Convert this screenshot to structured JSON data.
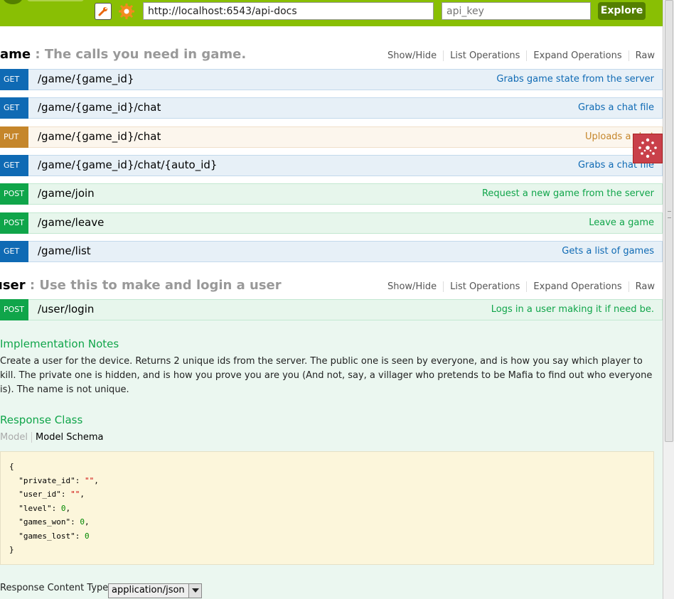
{
  "header": {
    "url_value": "http://localhost:6543/api-docs",
    "api_key_placeholder": "api_key",
    "explore_label": "Explore",
    "brand_color": "#89bf04"
  },
  "resources": [
    {
      "name": "ame",
      "description": " : The calls you need in game.",
      "ops_links": [
        "Show/Hide",
        "List Operations",
        "Expand Operations",
        "Raw"
      ]
    },
    {
      "name": "user",
      "description": " : Use this to make and login a user",
      "ops_links": [
        "Show/Hide",
        "List Operations",
        "Expand Operations",
        "Raw"
      ]
    }
  ],
  "game_ops": [
    {
      "method": "GET",
      "path": "/game/{game_id}",
      "summary": "Grabs game state from the server"
    },
    {
      "method": "GET",
      "path": "/game/{game_id}/chat",
      "summary": "Grabs a chat file"
    },
    {
      "method": "PUT",
      "path": "/game/{game_id}/chat",
      "summary": "Uploads a chat"
    },
    {
      "method": "GET",
      "path": "/game/{game_id}/chat/{auto_id}",
      "summary": "Grabs a chat file"
    },
    {
      "method": "POST",
      "path": "/game/join",
      "summary": "Request a new game from the server"
    },
    {
      "method": "POST",
      "path": "/game/leave",
      "summary": "Leave a game"
    },
    {
      "method": "GET",
      "path": "/game/list",
      "summary": "Gets a list of games"
    }
  ],
  "user_ops": [
    {
      "method": "POST",
      "path": "/user/login",
      "summary": "Logs in a user making it if need be."
    }
  ],
  "details": {
    "impl_title": "Implementation Notes",
    "impl_text": "Create a user for the device. Returns 2 unique ids from the server. The public one is seen by everyone, and is how you say which player to kill. The private one is hidden, and is how you prove you are you (And not, say, a villager who pretends to be Mafia to find out who everyone is). The name is not unique.",
    "response_class_title": "Response Class",
    "tab_model": "Model",
    "tab_schema": "Model Schema",
    "schema_fields": [
      {
        "key": "\"private_id\"",
        "value": "\"\"",
        "type": "string"
      },
      {
        "key": "\"user_id\"",
        "value": "\"\"",
        "type": "string"
      },
      {
        "key": "\"level\"",
        "value": "0",
        "type": "number"
      },
      {
        "key": "\"games_won\"",
        "value": "0",
        "type": "number"
      },
      {
        "key": "\"games_lost\"",
        "value": "0",
        "type": "number"
      }
    ],
    "response_content_type_label": "Response Content Type",
    "response_content_type_value": "application/json"
  }
}
